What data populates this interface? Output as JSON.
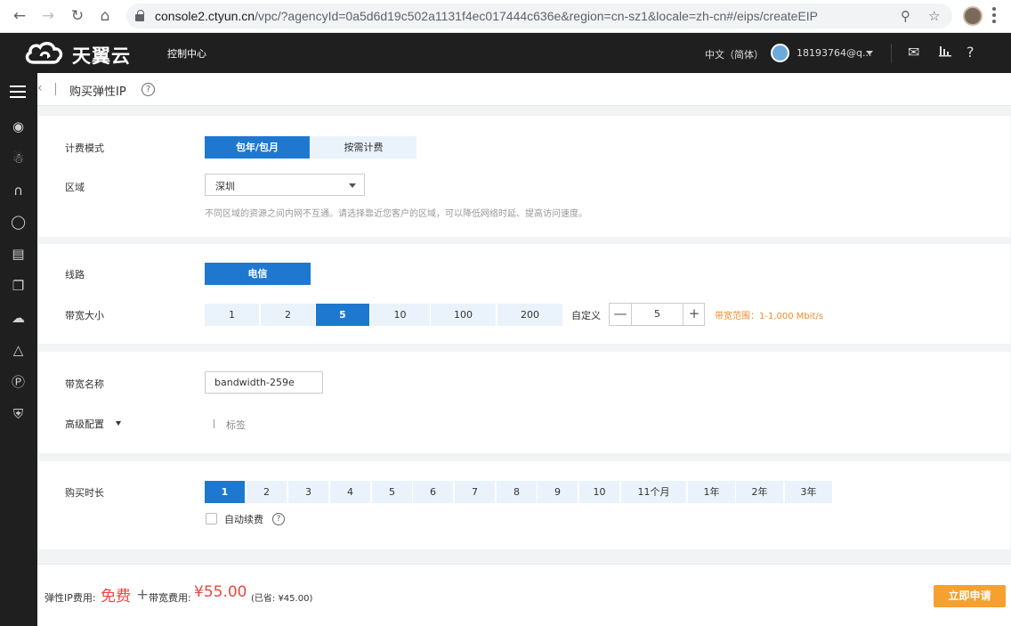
{
  "browser": {
    "url_host": "console2.ctyun.cn",
    "url_rest": "/vpc/?agencyId=0a5d6d19c502a1131f4ec017444c636e&region=cn-sz1&locale=zh-cn#/eips/createEIP"
  },
  "topnav": {
    "logo_text": "天翼云",
    "console": "控制中心",
    "language": "中文（简体）",
    "user": "18193764@q..."
  },
  "breadcrumb": {
    "title": "购买弹性IP"
  },
  "billing": {
    "label": "计费模式",
    "options": [
      "包年/包月",
      "按需计费"
    ],
    "selected": "包年/包月"
  },
  "region": {
    "label": "区域",
    "value": "深圳",
    "hint": "不同区域的资源之间内网不互通。请选择靠近您客户的区域，可以降低网络时延、提高访问速度。"
  },
  "line": {
    "label": "线路",
    "value": "电信"
  },
  "bandwidth": {
    "label": "带宽大小",
    "options": [
      "1",
      "2",
      "5",
      "10",
      "100",
      "200"
    ],
    "selected": "5",
    "custom_label": "自定义",
    "custom_value": "5",
    "range": "带宽范围：1-1,000 Mbit/s"
  },
  "bw_name": {
    "label": "带宽名称",
    "value": "bandwidth-259e"
  },
  "advanced": {
    "label": "高级配置",
    "tag": "标签"
  },
  "duration": {
    "label": "购买时长",
    "options": [
      "1",
      "2",
      "3",
      "4",
      "5",
      "6",
      "7",
      "8",
      "9",
      "10",
      "11个月",
      "1年",
      "2年",
      "3年"
    ],
    "selected": "1",
    "auto_renew": "自动续费"
  },
  "footer": {
    "eip_fee_label": "弹性IP费用:",
    "eip_fee": "免费",
    "bw_fee_label": "带宽费用:",
    "bw_fee": "¥55.00",
    "saved": "(已省: ¥45.00)",
    "buy": "立即申请"
  }
}
